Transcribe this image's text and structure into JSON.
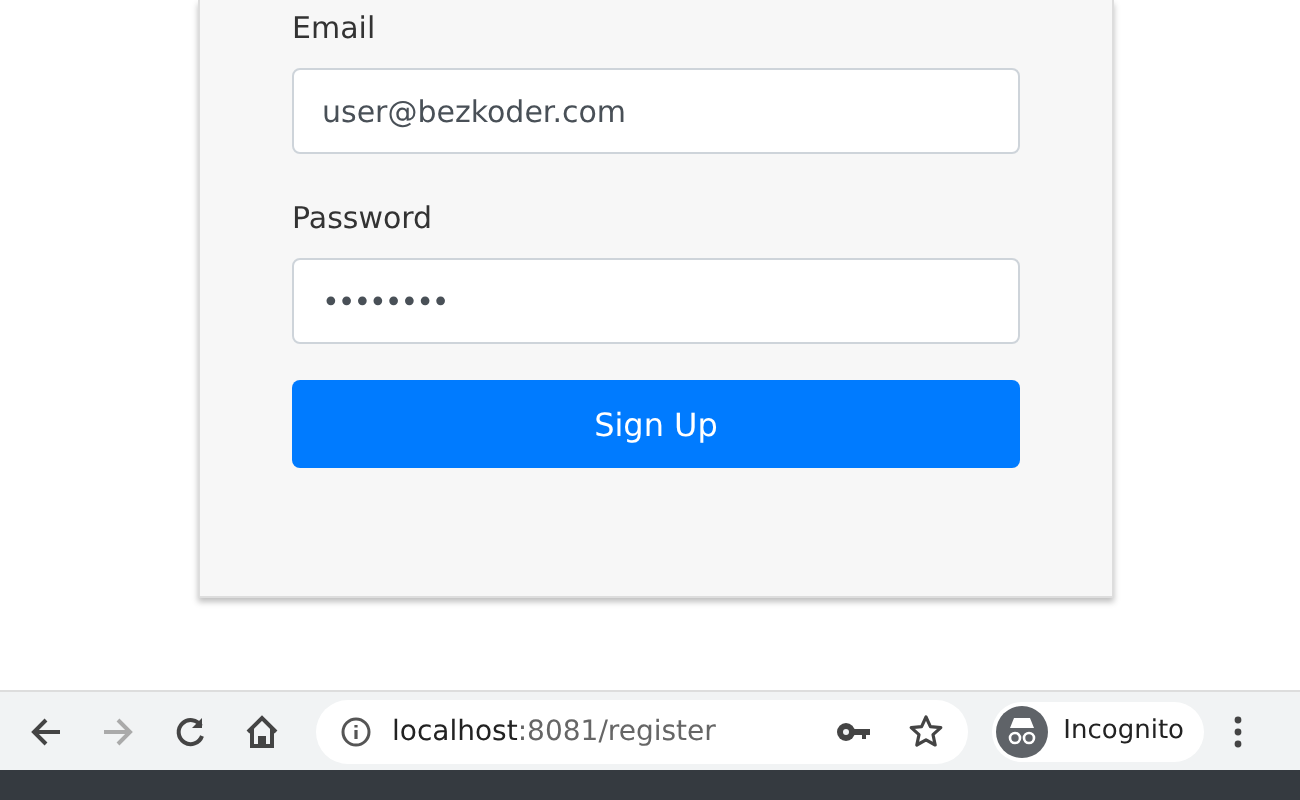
{
  "form": {
    "fields": [
      {
        "label": "Email",
        "kind": "text",
        "value": "user@bezkoder.com"
      },
      {
        "label": "Password",
        "kind": "password",
        "value": "••••••••"
      }
    ],
    "submit": "Sign Up"
  },
  "browser": {
    "back_disabled": false,
    "forward_disabled": true,
    "url": {
      "host": "localhost",
      "path": ":8081/register"
    },
    "profile": "Incognito"
  }
}
